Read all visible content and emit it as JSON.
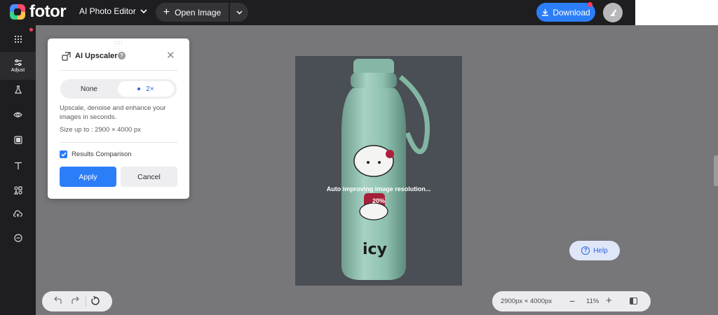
{
  "app": {
    "logo_text": "fotor",
    "editor_mode": "AI Photo Editor",
    "open_image_label": "Open Image",
    "download_label": "Download"
  },
  "sidebar": {
    "items": [
      {
        "icon": "grid-icon",
        "label": ""
      },
      {
        "icon": "sliders-icon",
        "label": "Adjust"
      },
      {
        "icon": "beaker-icon",
        "label": ""
      },
      {
        "icon": "eye-icon",
        "label": ""
      },
      {
        "icon": "frame-icon",
        "label": ""
      },
      {
        "icon": "text-icon",
        "label": ""
      },
      {
        "icon": "elements-icon",
        "label": ""
      },
      {
        "icon": "cloud-upload-icon",
        "label": ""
      },
      {
        "icon": "more-icon",
        "label": ""
      }
    ],
    "active_index": 1
  },
  "panel": {
    "title": "AI Upscaler",
    "help_glyph": "?",
    "options": [
      "None",
      "2×"
    ],
    "selected_option": "2×",
    "description": "Upscale, denoise and enhance your images in seconds.",
    "size_note": "Size up to : 2900 × 4000 px",
    "comparison_label": "Results Comparison",
    "comparison_checked": true,
    "apply_label": "Apply",
    "cancel_label": "Cancel"
  },
  "canvas": {
    "status_text": "Auto improving image resolution...",
    "progress_percent": "20%",
    "photo_text": "icy"
  },
  "bottom": {
    "dimensions": "2900px × 4000px",
    "zoom_level": "11%",
    "minus_glyph": "−",
    "plus_glyph": "+"
  },
  "help": {
    "label": "Help",
    "glyph": "?"
  },
  "colors": {
    "accent": "#2c7ef8",
    "topbar": "#1e1e21",
    "canvas_bg": "#777779",
    "notification": "#ff3b5c"
  }
}
